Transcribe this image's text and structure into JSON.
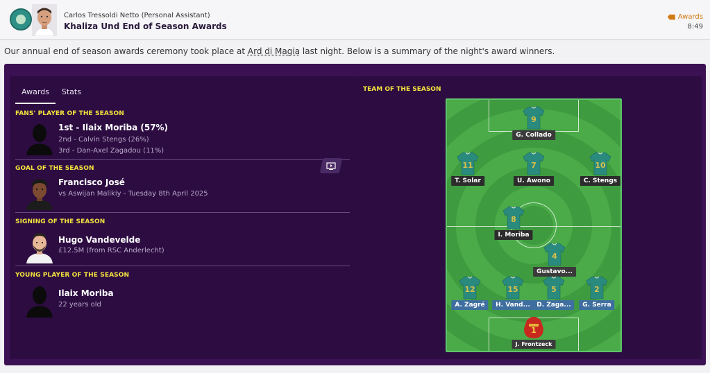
{
  "header": {
    "sender": "Carlos Tressoldi Netto  (Personal Assistant)",
    "subject": "Khaliza Und End of Season Awards",
    "tag_label": "Awards",
    "time": "8:49",
    "accent": "#d07a12"
  },
  "intro": {
    "before": "Our annual end of season awards ceremony took place at ",
    "venue": "Ard di Magia",
    "after": " last night. Below is a summary of the night's award winners."
  },
  "tabs": [
    "Awards",
    "Stats"
  ],
  "awards": {
    "fans": {
      "title": "FANS' PLAYER OF THE SEASON",
      "first": "1st - Ilaix Moriba (57%)",
      "second": "2nd - Calvin Stengs (26%)",
      "third": "3rd - Dan-Axel Zagadou (11%)"
    },
    "goal": {
      "title": "GOAL OF THE SEASON",
      "player": "Francisco José",
      "detail": "vs Aswijan Malikiy - Tuesday 8th April 2025"
    },
    "signing": {
      "title": "SIGNING OF THE SEASON",
      "player": "Hugo Vandevelde",
      "detail": "£12.5M (from RSC Anderlecht)"
    },
    "young": {
      "title": "YOUNG PLAYER OF THE SEASON",
      "player": "Ilaix Moriba",
      "detail": "22 years old"
    }
  },
  "team_of_season": {
    "title": "TEAM OF THE SEASON",
    "players": [
      {
        "number": "9",
        "name": "G. Collado"
      },
      {
        "number": "11",
        "name": "T. Solar"
      },
      {
        "number": "7",
        "name": "U. Awono"
      },
      {
        "number": "10",
        "name": "C. Stengs"
      },
      {
        "number": "8",
        "name": "I. Moriba"
      },
      {
        "number": "4",
        "name": "Gustavo..."
      },
      {
        "number": "12",
        "name": "A. Zagré"
      },
      {
        "number": "15",
        "name": "H. Vand..."
      },
      {
        "number": "5",
        "name": "D. Zaga..."
      },
      {
        "number": "2",
        "name": "G. Serra"
      },
      {
        "number": "1",
        "name": "J. Frontzeck"
      }
    ]
  },
  "colors": {
    "panel": "#3b1154",
    "section_title": "#f4e33d",
    "shirt": "#2a8a7e",
    "shirt_number": "#d8c04a",
    "gk_shirt": "#c8281e"
  }
}
